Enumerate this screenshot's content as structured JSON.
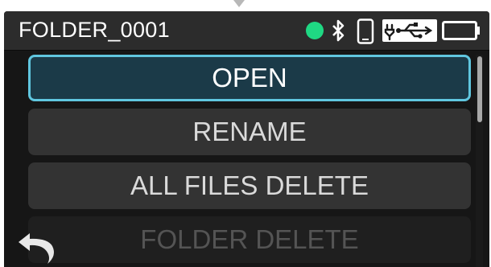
{
  "status_bar": {
    "folder_name": "FOLDER_0001",
    "icons": [
      "recording-status-dot",
      "bluetooth-icon",
      "phone-icon",
      "usb-power-icon",
      "battery-icon"
    ],
    "rec_dot_color": "#1fd883"
  },
  "menu": {
    "items": [
      {
        "label": "OPEN"
      },
      {
        "label": "RENAME"
      },
      {
        "label": "ALL FILES DELETE"
      },
      {
        "label": "FOLDER DELETE"
      }
    ],
    "selected_index": 0,
    "accent_color": "#60c6df"
  },
  "scroll": {
    "position_fraction": 0.0
  },
  "navigation": {
    "back_icon": "back-arrow-icon"
  }
}
